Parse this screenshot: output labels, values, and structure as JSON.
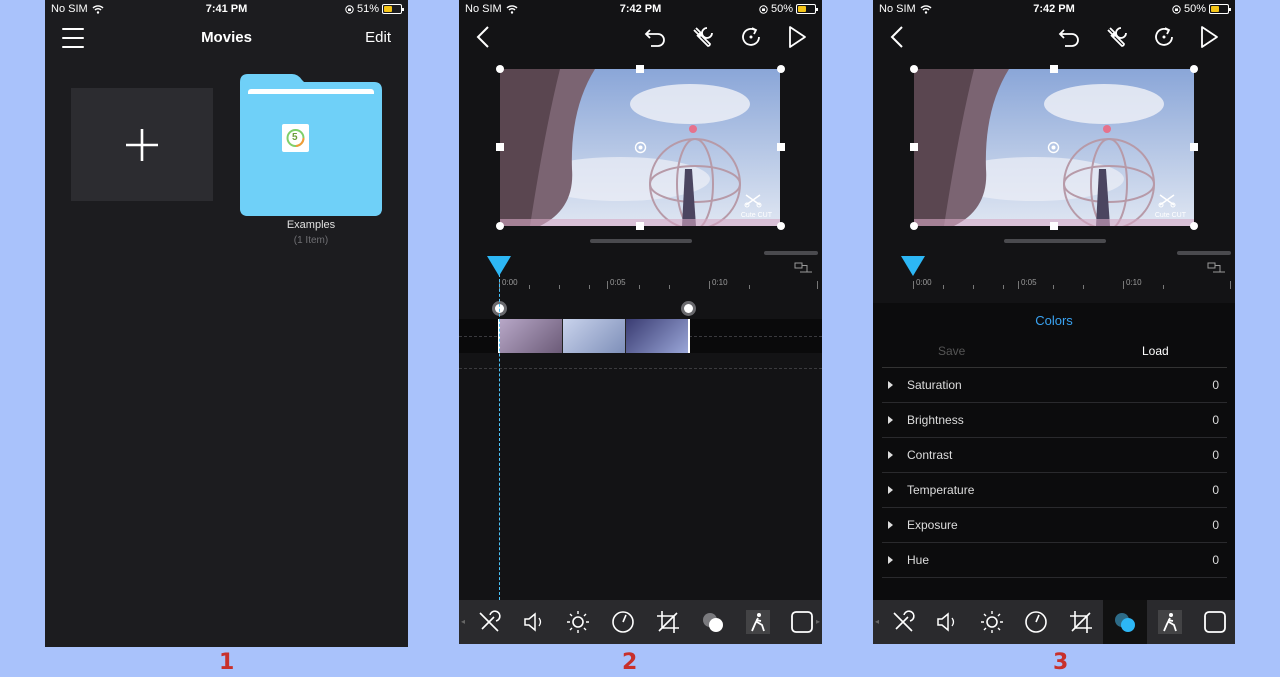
{
  "screens": [
    {
      "status": {
        "carrier": "No SIM",
        "time": "7:41 PM",
        "battery": "51%"
      },
      "nav": {
        "title": "Movies",
        "edit": "Edit"
      },
      "folder": {
        "name": "Examples",
        "count": "(1 Item)",
        "badge": "5"
      }
    },
    {
      "status": {
        "carrier": "No SIM",
        "time": "7:42 PM",
        "battery": "50%"
      },
      "watermark": "Cute CUT",
      "ruler": [
        "0:00",
        "0:05",
        "0:10"
      ]
    },
    {
      "status": {
        "carrier": "No SIM",
        "time": "7:42 PM",
        "battery": "50%"
      },
      "watermark": "Cute CUT",
      "ruler": [
        "0:00",
        "0:05",
        "0:10"
      ],
      "colors_panel": {
        "title": "Colors",
        "save": "Save",
        "load": "Load",
        "rows": [
          {
            "label": "Saturation",
            "value": "0"
          },
          {
            "label": "Brightness",
            "value": "0"
          },
          {
            "label": "Contrast",
            "value": "0"
          },
          {
            "label": "Temperature",
            "value": "0"
          },
          {
            "label": "Exposure",
            "value": "0"
          },
          {
            "label": "Hue",
            "value": "0"
          }
        ]
      }
    }
  ],
  "captions": [
    "1",
    "2",
    "3"
  ],
  "colors": {
    "accent": "#2db7f5",
    "caption": "#c8302b",
    "folder": "#6fd0f8"
  },
  "icons": {
    "toolbar": [
      "no-edit-icon",
      "volume-icon",
      "brightness-icon",
      "speed-icon",
      "crop-icon",
      "colors-icon",
      "motion-icon",
      "frame-icon"
    ],
    "top": [
      "back-icon",
      "undo-icon",
      "wrench-icon",
      "redo-icon",
      "play-icon"
    ]
  }
}
